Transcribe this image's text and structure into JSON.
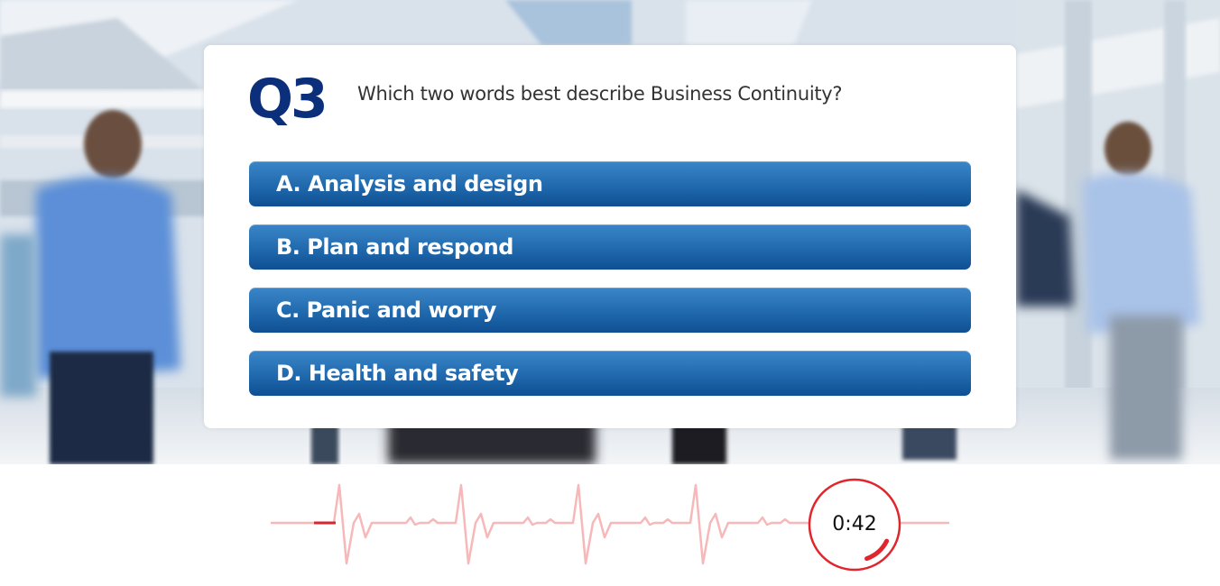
{
  "question": {
    "number": "Q3",
    "text": "Which two words best describe Business Continuity?"
  },
  "answers": [
    {
      "label": "A. Analysis and design"
    },
    {
      "label": "B. Plan and respond"
    },
    {
      "label": "C. Panic and worry"
    },
    {
      "label": "D. Health and safety"
    }
  ],
  "timer": {
    "display": "0:42",
    "remaining_fraction": 0.12,
    "ring_color": "#e0262c",
    "pulse_color": "#f7b8ba"
  },
  "colors": {
    "question_number": "#0b2f7a",
    "answer_button_top": "#3a86c8",
    "answer_button_bottom": "#0f4f93"
  }
}
